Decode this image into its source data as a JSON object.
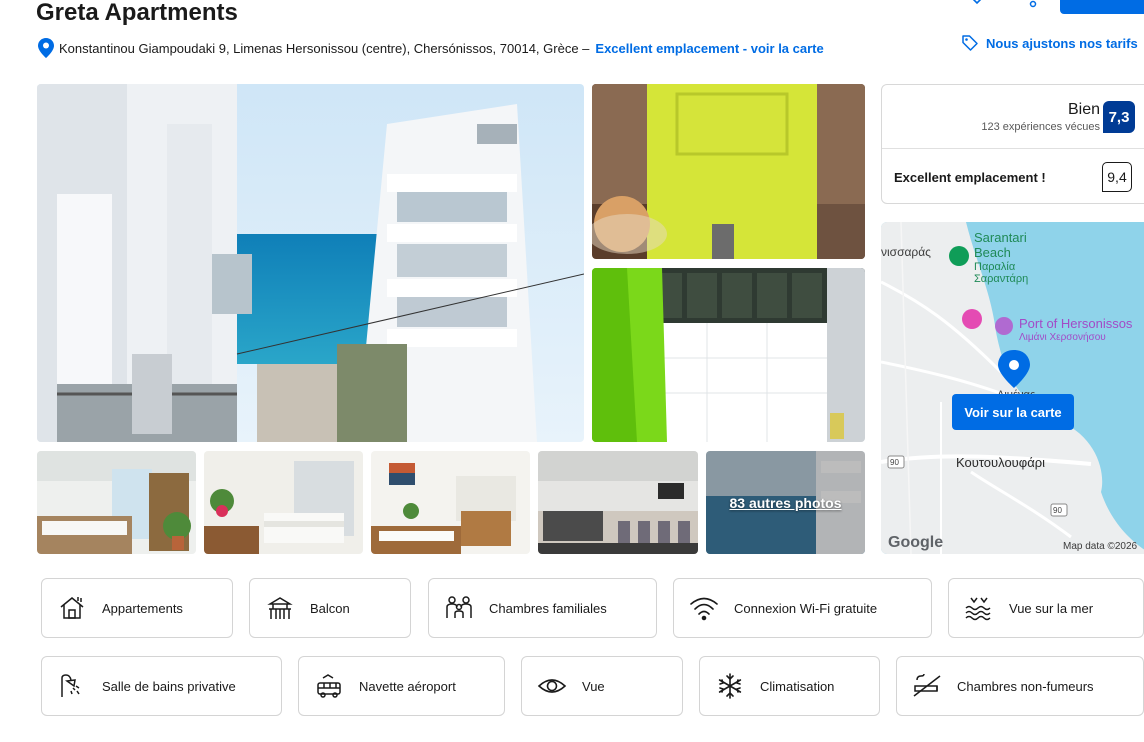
{
  "header": {
    "title": "Greta Apartments",
    "address": "Konstantinou Giampoudaki 9, Limenas Hersonissou (centre), Chersónissos, 70014, Grèce –",
    "location_link": "Excellent emplacement - voir la carte",
    "price_match": "Nous ajustons nos tarifs"
  },
  "gallery": {
    "more_photos_label": "83 autres photos"
  },
  "review": {
    "score_word": "Bien",
    "review_count": "123 expériences vécues",
    "score": "7,3",
    "location_label": "Excellent emplacement !",
    "location_score": "9,4"
  },
  "map": {
    "labels": {
      "town_left": "νισσαράς",
      "beach_en": "Sarantari",
      "beach_en2": "Beach",
      "beach_gr": "Παραλία",
      "beach_gr2": "Σαραντάρη",
      "port_en": "Port of Hersonissos",
      "port_gr": "Λιμάνι Χερσονήσου",
      "town_marker": "Λιμένας",
      "district": "Κουτουλουφάρι",
      "road_1": "90",
      "road_2": "90",
      "provider": "Google",
      "attribution": "Map data ©2026"
    },
    "button_label": "Voir sur la carte"
  },
  "facilities": [
    {
      "label": "Appartements",
      "icon": "apartment-icon"
    },
    {
      "label": "Balcon",
      "icon": "balcony-icon"
    },
    {
      "label": "Chambres familiales",
      "icon": "family-icon"
    },
    {
      "label": "Connexion Wi-Fi gratuite",
      "icon": "wifi-icon"
    },
    {
      "label": "Vue sur la mer",
      "icon": "sea-view-icon"
    },
    {
      "label": "Salle de bains privative",
      "icon": "shower-icon"
    },
    {
      "label": "Navette aéroport",
      "icon": "shuttle-icon"
    },
    {
      "label": "Vue",
      "icon": "eye-icon"
    },
    {
      "label": "Climatisation",
      "icon": "snowflake-icon"
    },
    {
      "label": "Chambres non-fumeurs",
      "icon": "no-smoking-icon"
    }
  ],
  "colors": {
    "brand_blue": "#006ce4",
    "score_blue": "#003b95"
  }
}
